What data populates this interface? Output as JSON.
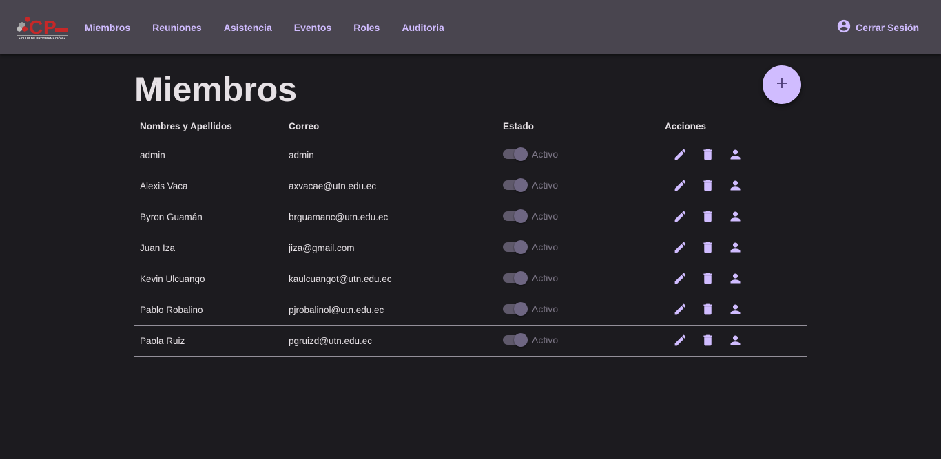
{
  "brand": {
    "logo_letters": "CP",
    "logo_subtitle": "CLUB DE PROGRAMACIÓN"
  },
  "nav": {
    "items": [
      {
        "label": "Miembros"
      },
      {
        "label": "Reuniones"
      },
      {
        "label": "Asistencia"
      },
      {
        "label": "Eventos"
      },
      {
        "label": "Roles"
      },
      {
        "label": "Auditoria"
      }
    ],
    "logout_label": "Cerrar Sesión"
  },
  "page": {
    "title": "Miembros",
    "add_button_icon": "plus-icon"
  },
  "table": {
    "headers": {
      "name": "Nombres y Apellidos",
      "email": "Correo",
      "status": "Estado",
      "actions": "Acciones"
    },
    "rows": [
      {
        "name": "admin",
        "email": "admin",
        "status": "Activo",
        "active": true
      },
      {
        "name": "Alexis Vaca",
        "email": "axvacae@utn.edu.ec",
        "status": "Activo",
        "active": true
      },
      {
        "name": "Byron Guamán",
        "email": "brguamanc@utn.edu.ec",
        "status": "Activo",
        "active": true
      },
      {
        "name": "Juan Iza",
        "email": "jiza@gmail.com",
        "status": "Activo",
        "active": true
      },
      {
        "name": "Kevin Ulcuango",
        "email": "kaulcuangot@utn.edu.ec",
        "status": "Activo",
        "active": true
      },
      {
        "name": "Pablo Robalino",
        "email": "pjrobalinol@utn.edu.ec",
        "status": "Activo",
        "active": true
      },
      {
        "name": "Paola Ruiz",
        "email": "pgruizd@utn.edu.ec",
        "status": "Activo",
        "active": true
      }
    ],
    "row_actions": [
      {
        "icon": "pencil-icon",
        "name": "edit"
      },
      {
        "icon": "trash-icon",
        "name": "delete"
      },
      {
        "icon": "person-icon",
        "name": "assign-role"
      }
    ]
  },
  "colors": {
    "accent": "#d0bcff",
    "background": "#1c1b1f",
    "topbar": "#49454f",
    "text": "#e6e1e5",
    "muted": "#7d7787",
    "divider": "#938f99",
    "logo_red": "#c62828",
    "logo_gray": "#9e9e9e"
  }
}
